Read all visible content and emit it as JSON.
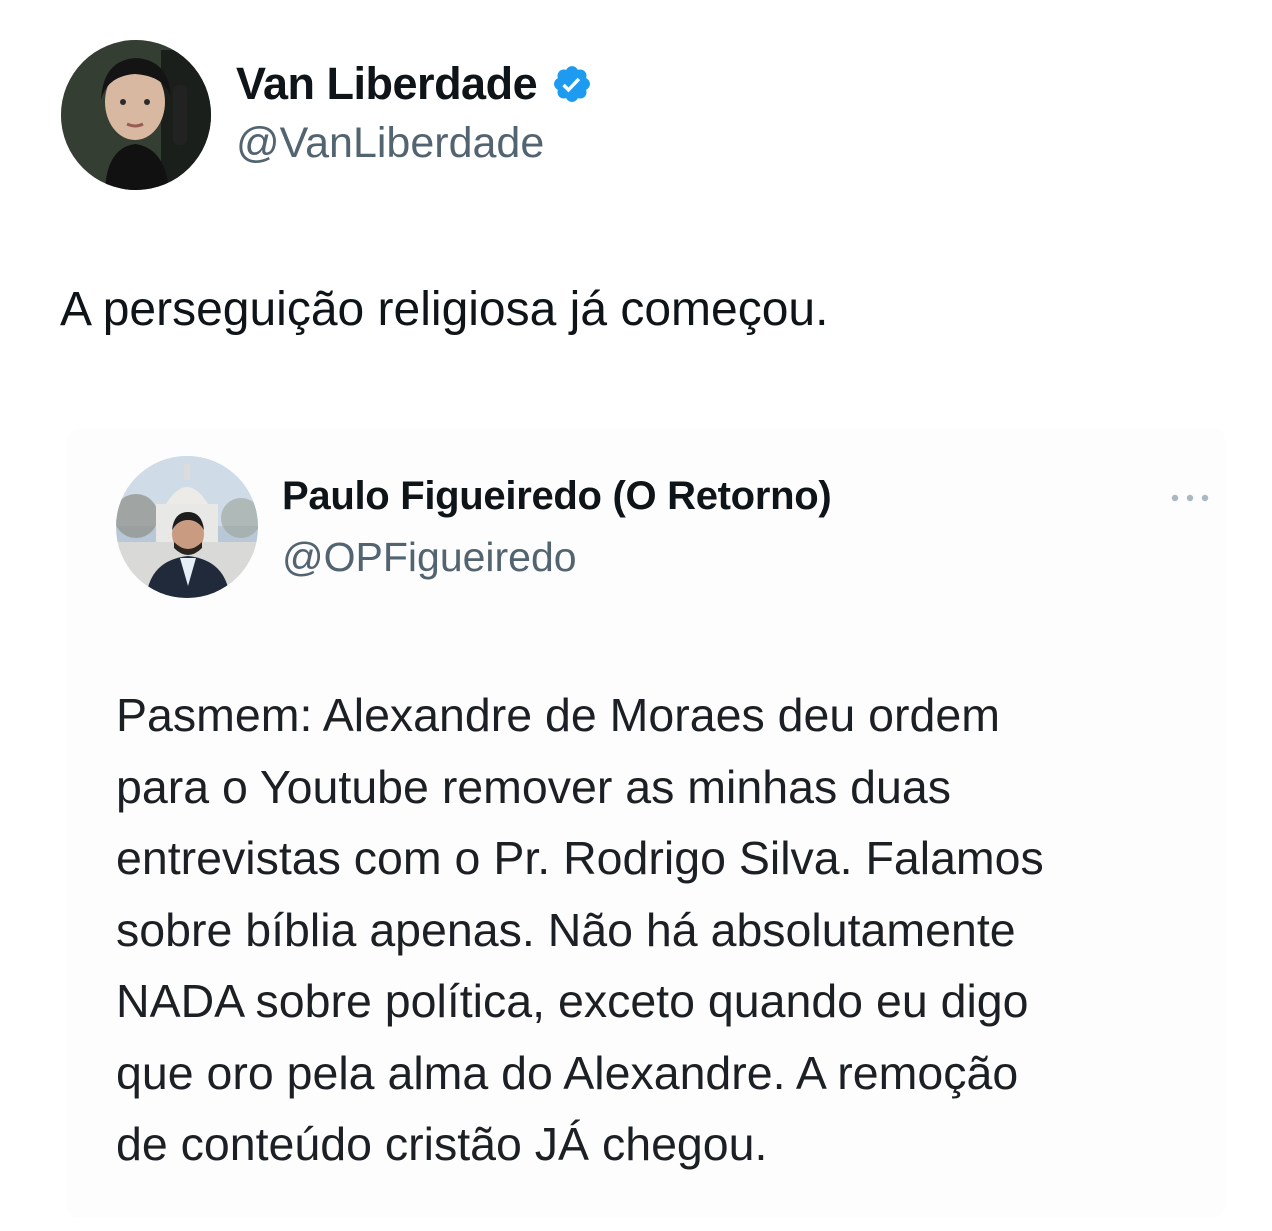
{
  "tweet": {
    "author": {
      "name": "Van Liberdade",
      "handle": "@VanLiberdade",
      "verified": true,
      "avatar_icon": "user-photo-avatar"
    },
    "text": "A perseguição religiosa já começou."
  },
  "quoted_tweet": {
    "author": {
      "name": "Paulo Figueiredo (O Retorno)",
      "handle": "@OPFigueiredo",
      "avatar_icon": "user-photo-avatar"
    },
    "more_icon": "ellipsis-icon",
    "text_lines": [
      "Pasmem: Alexandre de Moraes deu ordem",
      "para o Youtube remover as minhas duas",
      "entrevistas com o Pr. Rodrigo Silva. Falamos",
      "sobre bíblia apenas. Não há absolutamente",
      "NADA sobre política, exceto quando eu digo",
      "que oro pela alma do Alexandre. A remoção",
      "de conteúdo cristão JÁ chegou."
    ]
  },
  "colors": {
    "verified_blue": "#1d9bf0",
    "handle_gray": "#536471",
    "text_dark": "#0f1419"
  }
}
